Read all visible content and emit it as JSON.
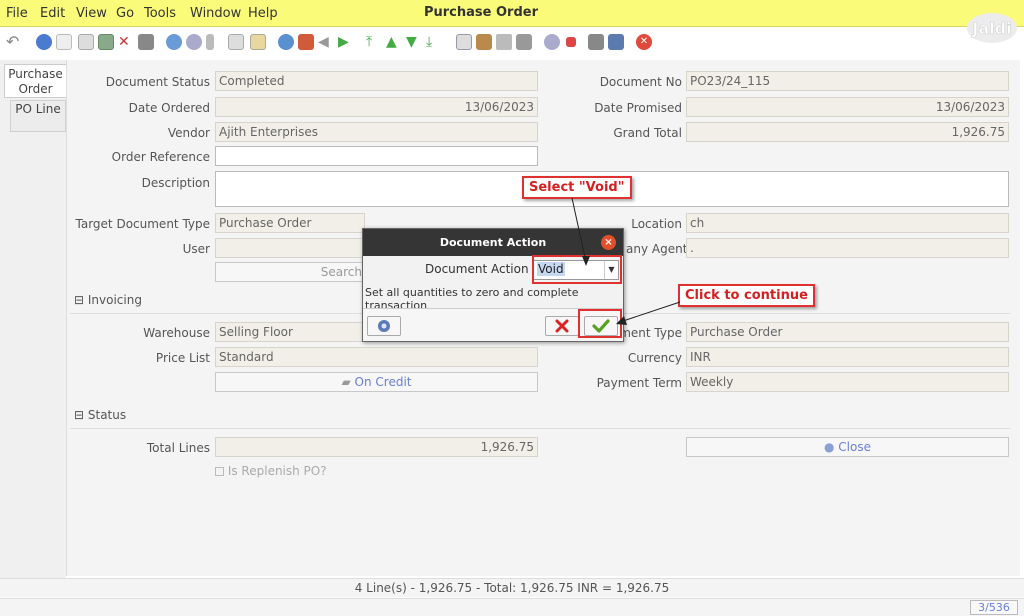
{
  "menu": [
    {
      "label": "File"
    },
    {
      "label": "Edit"
    },
    {
      "label": "View"
    },
    {
      "label": "Go"
    },
    {
      "label": "Tools"
    },
    {
      "label": "Window"
    },
    {
      "label": "Help"
    }
  ],
  "window_title": "Purchase Order",
  "logo_text": "Jaldi",
  "tabs": [
    {
      "label": "Purchase Order"
    },
    {
      "label": "PO Line"
    }
  ],
  "form": {
    "document_status": {
      "label": "Document Status",
      "value": "Completed"
    },
    "document_no": {
      "label": "Document No",
      "value": "PO23/24_115"
    },
    "date_ordered": {
      "label": "Date Ordered",
      "value": "13/06/2023"
    },
    "date_promised": {
      "label": "Date Promised",
      "value": "13/06/2023"
    },
    "vendor": {
      "label": "Vendor",
      "value": "Ajith Enterprises"
    },
    "grand_total": {
      "label": "Grand Total",
      "value": "1,926.75"
    },
    "order_reference": {
      "label": "Order Reference",
      "value": ""
    },
    "description": {
      "label": "Description",
      "value": ""
    },
    "target_doc_type": {
      "label": "Target Document Type",
      "value": "Purchase Order"
    },
    "location": {
      "label": "Location",
      "value": "ch"
    },
    "user": {
      "label": "User",
      "value": ""
    },
    "company_agent": {
      "label": "any Agent",
      "value": "."
    },
    "search_button": "Search"
  },
  "invoicing": {
    "section_label": "Invoicing",
    "warehouse": {
      "label": "Warehouse",
      "value": "Selling Floor"
    },
    "document_type": {
      "label": "ment Type",
      "value": "Purchase Order"
    },
    "price_list": {
      "label": "Price List",
      "value": "Standard"
    },
    "currency": {
      "label": "Currency",
      "value": "INR"
    },
    "on_credit_button": "On Credit",
    "payment_term": {
      "label": "Payment Term",
      "value": "Weekly"
    }
  },
  "status": {
    "section_label": "Status",
    "total_lines": {
      "label": "Total Lines",
      "value": "1,926.75"
    },
    "close_button": "Close",
    "is_replenish": "Is Replenish PO?"
  },
  "dialog": {
    "title": "Document Action",
    "close_glyph": "×",
    "field_label": "Document Action",
    "selected_value": "Void",
    "description": "Set all quantities to zero and complete transaction"
  },
  "callouts": {
    "select_void": "Select \"Void\"",
    "click_continue": "Click to continue"
  },
  "statusbar": {
    "summary": "4 Line(s) - 1,926.75 - Total: 1,926.75 INR = 1,926.75",
    "pager": "3/536"
  },
  "colors": {
    "menubar": "#fbfb7a",
    "accent_link": "#6a7fd6",
    "callout_red": "#e03030"
  }
}
